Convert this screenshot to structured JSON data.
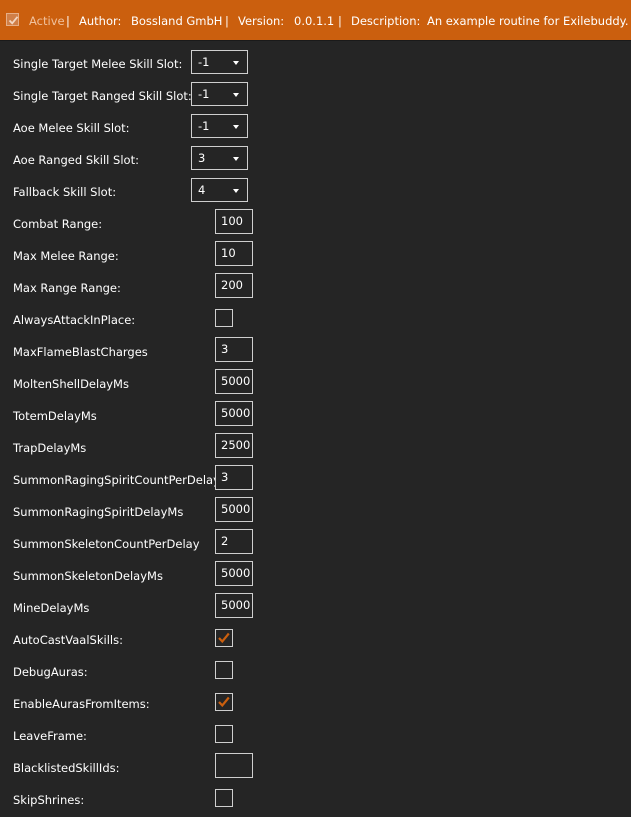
{
  "header": {
    "active_label": "Active",
    "sep": "|",
    "author_label": "Author:",
    "author_value": "Bossland GmbH",
    "version_label": "Version:",
    "version_value": "0.0.1.1",
    "description_label": "Description:",
    "description_value": "An example routine for Exilebuddy.",
    "active_checked": true,
    "accent_color": "#cb5f0e"
  },
  "settings": {
    "single_target_melee_skill_slot": {
      "label": "Single Target Melee Skill Slot:",
      "value": "-1"
    },
    "single_target_ranged_skill_slot": {
      "label": "Single Target Ranged Skill Slot:",
      "value": "-1"
    },
    "aoe_melee_skill_slot": {
      "label": "Aoe Melee Skill Slot:",
      "value": "-1"
    },
    "aoe_ranged_skill_slot": {
      "label": "Aoe Ranged Skill Slot:",
      "value": "3"
    },
    "fallback_skill_slot": {
      "label": "Fallback Skill Slot:",
      "value": "4"
    },
    "combat_range": {
      "label": "Combat Range:",
      "value": "100"
    },
    "max_melee_range": {
      "label": "Max Melee Range:",
      "value": "10"
    },
    "max_range_range": {
      "label": "Max Range Range:",
      "value": "200"
    },
    "always_attack_in_place": {
      "label": "AlwaysAttackInPlace:",
      "checked": false
    },
    "max_flame_blast_charges": {
      "label": "MaxFlameBlastCharges",
      "value": "3"
    },
    "molten_shell_delay_ms": {
      "label": "MoltenShellDelayMs",
      "value": "5000"
    },
    "totem_delay_ms": {
      "label": "TotemDelayMs",
      "value": "5000"
    },
    "trap_delay_ms": {
      "label": "TrapDelayMs",
      "value": "2500"
    },
    "summon_raging_spirit_count_per_delay": {
      "label": "SummonRagingSpiritCountPerDelay",
      "value": "3"
    },
    "summon_raging_spirit_delay_ms": {
      "label": "SummonRagingSpiritDelayMs",
      "value": "5000"
    },
    "summon_skeleton_count_per_delay": {
      "label": "SummonSkeletonCountPerDelay",
      "value": "2"
    },
    "summon_skeleton_delay_ms": {
      "label": "SummonSkeletonDelayMs",
      "value": "5000"
    },
    "mine_delay_ms": {
      "label": "MineDelayMs",
      "value": "5000"
    },
    "auto_cast_vaal_skills": {
      "label": "AutoCastVaalSkills:",
      "checked": true
    },
    "debug_auras": {
      "label": "DebugAuras:",
      "checked": false
    },
    "enable_auras_from_items": {
      "label": "EnableAurasFromItems:",
      "checked": true
    },
    "leave_frame": {
      "label": "LeaveFrame:",
      "checked": false
    },
    "blacklisted_skill_ids": {
      "label": "BlacklistedSkillIds:",
      "value": ""
    },
    "skip_shrines": {
      "label": "SkipShrines:",
      "checked": false
    }
  },
  "icons": {
    "active_check": "checkmark-icon",
    "combo_arrow": "dropdown-arrow-icon",
    "checkbox_check": "checkmark-icon"
  },
  "colors": {
    "background": "#252525",
    "text": "#ffffff",
    "control_border": "#cfcfcf",
    "checkmark": "#cb5f0e"
  }
}
